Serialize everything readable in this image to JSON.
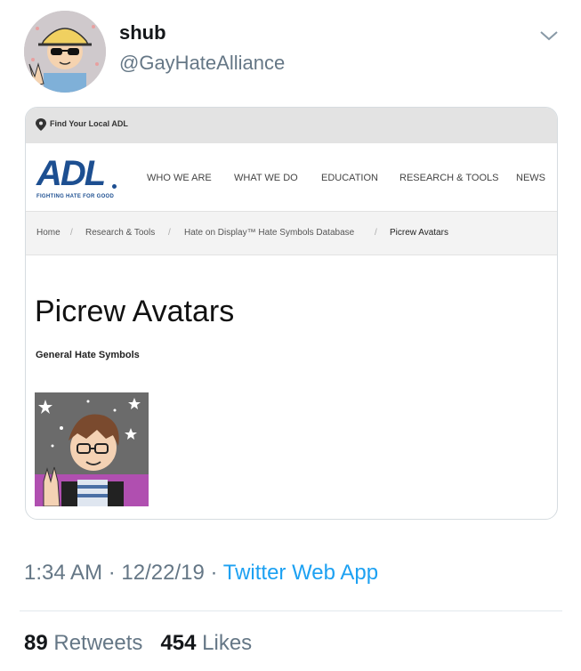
{
  "tweet": {
    "display_name": "shub",
    "handle": "@GayHateAlliance",
    "timestamp": "1:34 AM",
    "date": "12/22/19",
    "separator": "·",
    "source": "Twitter Web App",
    "retweets": {
      "count": "89",
      "label": "Retweets"
    },
    "likes": {
      "count": "454",
      "label": "Likes"
    }
  },
  "embedded_page": {
    "top_link": "Find Your Local ADL",
    "logo": {
      "text": "ADL",
      "tagline": "FIGHTING HATE FOR GOOD",
      "color": "#1d4f91"
    },
    "nav": [
      "WHO WE ARE",
      "WHAT WE DO",
      "EDUCATION",
      "RESEARCH & TOOLS",
      "NEWS"
    ],
    "breadcrumb": [
      "Home",
      "Research & Tools",
      "Hate on Display™ Hate Symbols Database",
      "Picrew Avatars"
    ],
    "breadcrumb_separator": "/",
    "title": "Picrew Avatars",
    "category": "General Hate Symbols"
  },
  "colors": {
    "link": "#1da1f2",
    "muted": "#657786"
  },
  "icons": {
    "menu": "chevron-down-icon",
    "location": "map-pin-icon"
  }
}
